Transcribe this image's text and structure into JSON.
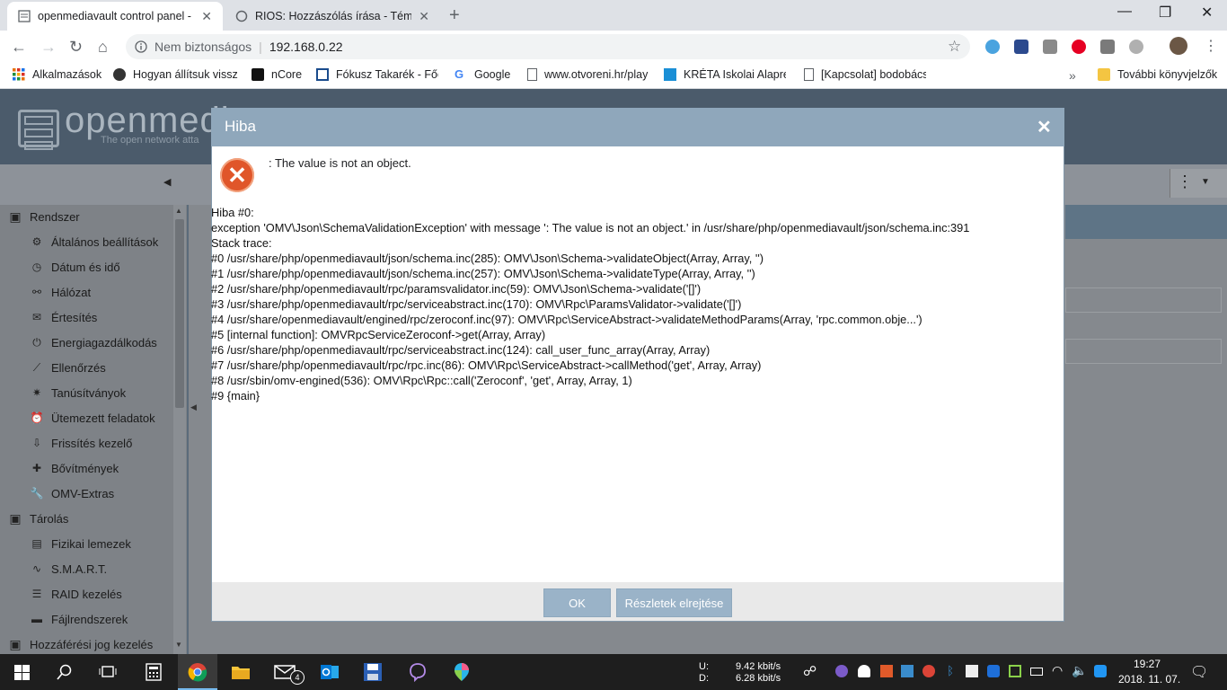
{
  "browser": {
    "tabs": [
      {
        "title": "openmediavault control panel - O",
        "active": true
      },
      {
        "title": "RIOS: Hozzászólás írása - Téma: C",
        "active": false
      }
    ],
    "window_controls": {
      "minimize": "—",
      "maximize": "❐",
      "close": "✕"
    },
    "address": {
      "security_label": "Nem biztonságos",
      "url": "192.168.0.22"
    },
    "bookmarks": [
      "Alkalmazások",
      "Hogyan állítsuk vissz",
      "nCore",
      "Fókusz Takarék - Főo",
      "Google",
      "www.otvoreni.hr/play",
      "KRÉTA Iskolai Alapren",
      "[Kapcsolat] bodobács",
      "További könyvjelzők"
    ]
  },
  "omv": {
    "logo_text": "openmedi",
    "logo_subtitle": "The open network atta",
    "sidebar": [
      {
        "label": "Rendszer",
        "section": true,
        "icon": "minus-square-icon"
      },
      {
        "label": "Általános beállítások",
        "icon": "cogs-icon"
      },
      {
        "label": "Dátum és idő",
        "icon": "clock-icon"
      },
      {
        "label": "Hálózat",
        "icon": "network-icon"
      },
      {
        "label": "Értesítés",
        "icon": "envelope-icon"
      },
      {
        "label": "Energiagazdálkodás",
        "icon": "power-icon"
      },
      {
        "label": "Ellenőrzés",
        "icon": "chart-line-icon"
      },
      {
        "label": "Tanúsítványok",
        "icon": "certificate-icon"
      },
      {
        "label": "Ütemezett feladatok",
        "icon": "alarm-clock-icon"
      },
      {
        "label": "Frissítés kezelő",
        "icon": "download-icon"
      },
      {
        "label": "Bővítmények",
        "icon": "puzzle-icon"
      },
      {
        "label": "OMV-Extras",
        "icon": "wrench-icon"
      },
      {
        "label": "Tárolás",
        "section": true,
        "icon": "minus-square-icon"
      },
      {
        "label": "Fizikai lemezek",
        "icon": "hdd-icon"
      },
      {
        "label": "S.M.A.R.T.",
        "icon": "pulse-icon"
      },
      {
        "label": "RAID kezelés",
        "icon": "database-icon"
      },
      {
        "label": "Fájlrendszerek",
        "icon": "folder-icon"
      },
      {
        "label": "Hozzáférési jog kezelés",
        "section": true,
        "icon": "minus-square-icon"
      }
    ]
  },
  "dialog": {
    "title": "Hiba",
    "message": ": The value is not an object.",
    "trace_lines": [
      "Hiba #0:",
      "exception 'OMV\\Json\\SchemaValidationException' with message ': The value is not an object.' in /usr/share/php/openmediavault/json/schema.inc:391",
      "Stack trace:",
      "#0 /usr/share/php/openmediavault/json/schema.inc(285): OMV\\Json\\Schema->validateObject(Array, Array, '')",
      "#1 /usr/share/php/openmediavault/json/schema.inc(257): OMV\\Json\\Schema->validateType(Array, Array, '')",
      "#2 /usr/share/php/openmediavault/rpc/paramsvalidator.inc(59): OMV\\Json\\Schema->validate('[]')",
      "#3 /usr/share/php/openmediavault/rpc/serviceabstract.inc(170): OMV\\Rpc\\ParamsValidator->validate('[]')",
      "#4 /usr/share/openmediavault/engined/rpc/zeroconf.inc(97): OMV\\Rpc\\ServiceAbstract->validateMethodParams(Array, 'rpc.common.obje...')",
      "#5 [internal function]: OMVRpcServiceZeroconf->get(Array, Array)",
      "#6 /usr/share/php/openmediavault/rpc/serviceabstract.inc(124): call_user_func_array(Array, Array)",
      "#7 /usr/share/php/openmediavault/rpc/rpc.inc(86): OMV\\Rpc\\ServiceAbstract->callMethod('get', Array, Array)",
      "#8 /usr/sbin/omv-engined(536): OMV\\Rpc\\Rpc::call('Zeroconf', 'get', Array, Array, 1)",
      "#9 {main}"
    ],
    "ok_label": "OK",
    "details_label": "Részletek elrejtése"
  },
  "taskbar": {
    "net_up_label": "U:",
    "net_down_label": "D:",
    "net_up": "9.42 kbit/s",
    "net_down": "6.28 kbit/s",
    "mail_badge": "4",
    "time": "19:27",
    "date": "2018. 11. 07."
  }
}
